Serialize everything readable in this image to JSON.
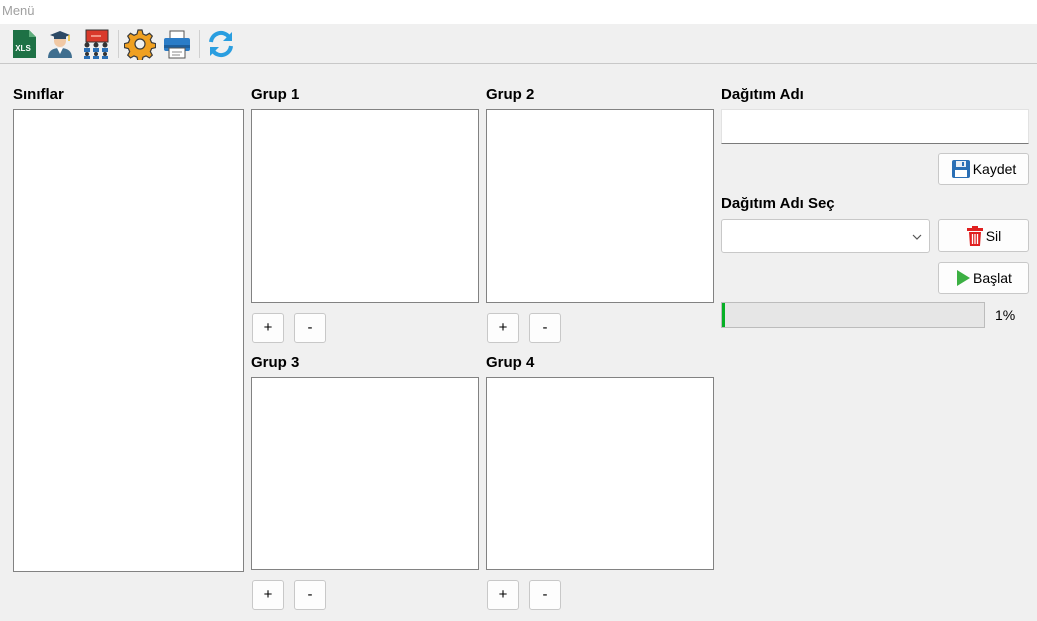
{
  "menu": {
    "title": "Menü"
  },
  "toolbar": {
    "items": [
      {
        "name": "excel-icon",
        "text": "XLS"
      },
      {
        "name": "teacher-icon"
      },
      {
        "name": "classroom-icon"
      },
      {
        "name": "settings-icon"
      },
      {
        "name": "print-icon"
      },
      {
        "name": "refresh-icon"
      }
    ]
  },
  "panels": {
    "siniflar_label": "Sınıflar",
    "grup1_label": "Grup 1",
    "grup2_label": "Grup 2",
    "grup3_label": "Grup 3",
    "grup4_label": "Grup 4",
    "plus": "+",
    "minus": "-"
  },
  "right": {
    "dagitim_adi_label": "Dağıtım Adı",
    "dagitim_adi_value": "",
    "kaydet_label": "Kaydet",
    "dagitim_sec_label": "Dağıtım Adı Seç",
    "dagitim_sec_value": "",
    "sil_label": "Sil",
    "baslat_label": "Başlat",
    "progress_value": 0.01,
    "progress_text": "1%"
  },
  "colors": {
    "progress_fill": "#06b025",
    "delete_red": "#e02020",
    "play_green": "#3cb043",
    "save_blue": "#2a6fb5"
  }
}
